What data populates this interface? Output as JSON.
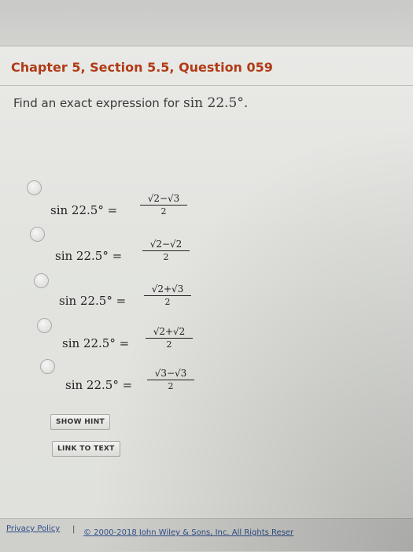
{
  "question": {
    "title": "Chapter 5, Section 5.5, Question 059",
    "prompt_text": "Find an exact expression for ",
    "prompt_expr": "sin 22.5°."
  },
  "options": [
    {
      "lhs": "sin  22.5° =",
      "numerator": "√2−√3",
      "denominator": "2"
    },
    {
      "lhs": "sin  22.5° =",
      "numerator": "√2−√2",
      "denominator": "2"
    },
    {
      "lhs": "sin  22.5° =",
      "numerator": "√2+√3",
      "denominator": "2"
    },
    {
      "lhs": "sin  22.5° =",
      "numerator": "√2+√2",
      "denominator": "2"
    },
    {
      "lhs": "sin  22.5° =",
      "numerator": "√3−√3",
      "denominator": "2"
    }
  ],
  "buttons": {
    "show_hint": "SHOW HINT",
    "link_to_text": "LINK TO TEXT"
  },
  "footer": {
    "privacy": "Privacy Policy",
    "separator": "|",
    "copyright": "© 2000-2018 John Wiley & Sons, Inc. All Rights Reser"
  },
  "colors": {
    "title": "#b03b16",
    "link": "#2f4f87"
  }
}
